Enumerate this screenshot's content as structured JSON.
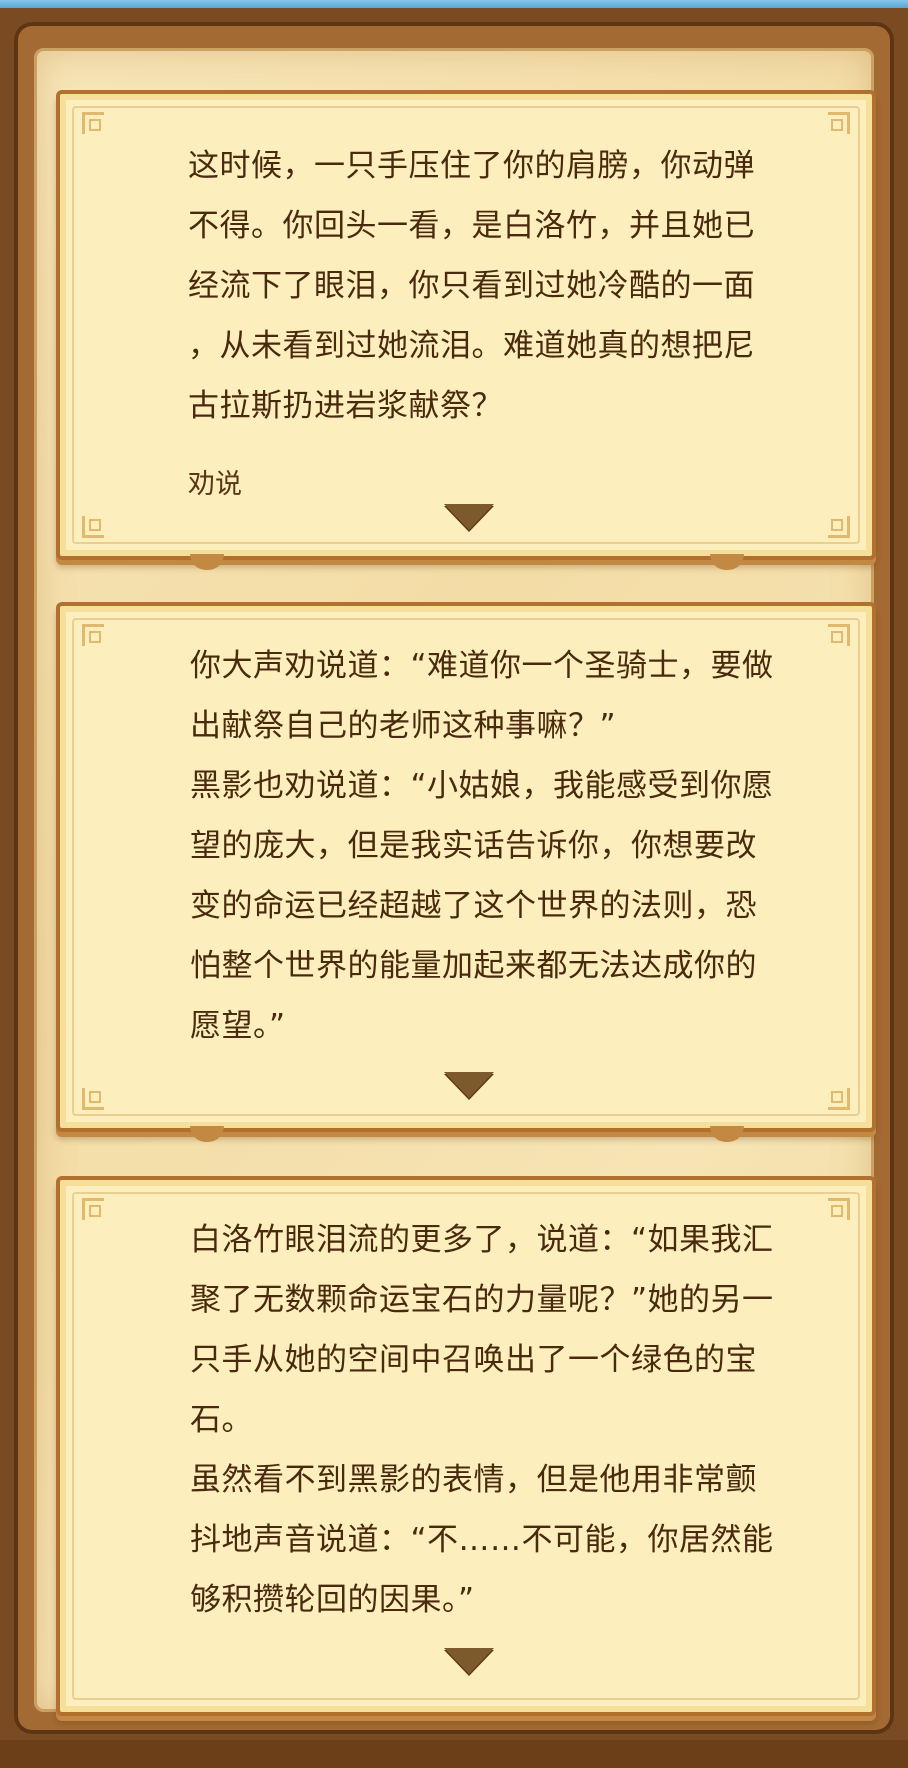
{
  "dialog_cards": [
    {
      "paragraphs": [
        "这时候，一只手压住了你的肩膀，你动弹不得。你回头一看，是白洛竹，并且她已经流下了眼泪，你只看到过她冷酷的一面，从未看到过她流泪。难道她真的想把尼古拉斯扔进岩浆献祭？"
      ],
      "lines": [
        "这时候，一只手压住了你的肩膀，你动弹",
        "不得。你回头一看，是白洛竹，并且她已",
        "经流下了眼泪，你只看到过她冷酷的一面",
        "，从未看到过她流泪。难道她真的想把尼",
        "古拉斯扔进岩浆献祭？"
      ],
      "option": "劝说"
    },
    {
      "lines": [
        "你大声劝说道：“难道你一个圣骑士，要做",
        "出献祭自己的老师这种事嘛？”",
        "黑影也劝说道：“小姑娘，我能感受到你愿",
        "望的庞大，但是我实话告诉你，你想要改",
        "变的命运已经超越了这个世界的法则，恐",
        "怕整个世界的能量加起来都无法达成你的",
        "愿望。”"
      ]
    },
    {
      "lines": [
        "白洛竹眼泪流的更多了，说道：“如果我汇",
        "聚了无数颗命运宝石的力量呢？”她的另一",
        "只手从她的空间中召唤出了一个绿色的宝",
        "石。",
        "虽然看不到黑影的表情，但是他用非常颤",
        "抖地声音说道：“不……不可能，你居然能",
        "够积攒轮回的因果。”"
      ]
    }
  ],
  "icons": {
    "continue": "down-triangle-icon",
    "corner": "corner-ornament-icon"
  },
  "colors": {
    "frame": "#7a4b22",
    "parchment": "#f3dca6",
    "card": "#fcefbd",
    "card_border": "#b2702e",
    "text": "#4a2a0e",
    "arrow": "#7d5a2c"
  }
}
